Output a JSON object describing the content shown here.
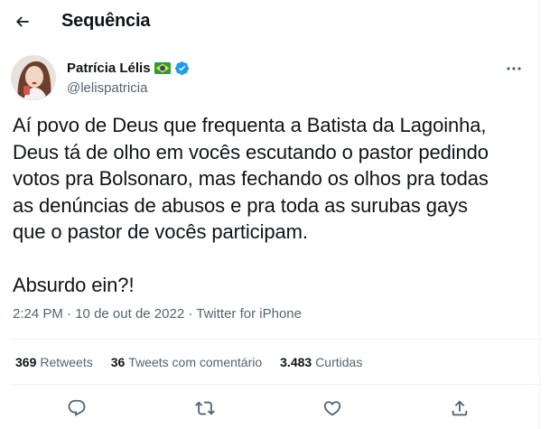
{
  "header": {
    "title": "Sequência"
  },
  "author": {
    "name": "Patrícia Lélis",
    "handle": "@lelispatricia",
    "flag": "brazil-flag",
    "verified": true
  },
  "tweet": {
    "text": "Aí povo de Deus que frequenta a Batista da Lagoinha,\nDeus tá de olho em vocês escutando o pastor pedindo\nvotos pra Bolsonaro, mas fechando os olhos pra todas\nas denúncias de abusos e pra toda as surubas gays\nque o pastor de vocês participam.\n\nAbsurdo ein?!",
    "time": "2:24 PM",
    "separator": "·",
    "date": "10 de out de 2022",
    "source": "Twitter for iPhone"
  },
  "stats": {
    "retweets_count": "369",
    "retweets_label": "Retweets",
    "quotes_count": "36",
    "quotes_label": "Tweets com comentário",
    "likes_count": "3.483",
    "likes_label": "Curtidas"
  },
  "actions": [
    "reply-icon",
    "retweet-icon",
    "like-icon",
    "share-icon"
  ],
  "colors": {
    "text": "#0f1419",
    "secondary": "#536471",
    "verified": "#1d9bf0",
    "divider": "#eff3f4"
  }
}
